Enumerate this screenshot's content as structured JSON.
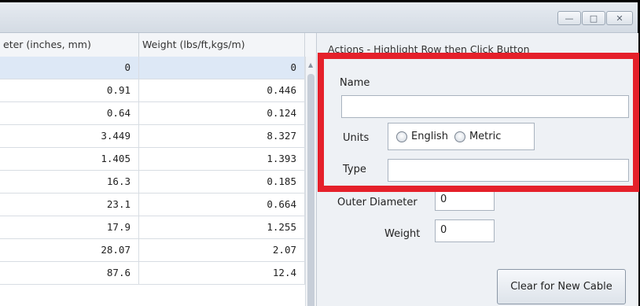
{
  "titlebar": {
    "minimize_icon": "minimize-icon",
    "maximize_icon": "maximize-icon",
    "close_icon": "close-icon"
  },
  "grid": {
    "columns": [
      "eter (inches, mm)",
      "Weight (lbs/ft,kgs/m)"
    ],
    "rows": [
      [
        "0",
        "0"
      ],
      [
        "0.91",
        "0.446"
      ],
      [
        "0.64",
        "0.124"
      ],
      [
        "3.449",
        "8.327"
      ],
      [
        "1.405",
        "1.393"
      ],
      [
        "16.3",
        "0.185"
      ],
      [
        "23.1",
        "0.664"
      ],
      [
        "17.9",
        "1.255"
      ],
      [
        "28.07",
        "2.07"
      ],
      [
        "87.6",
        "12.4"
      ]
    ]
  },
  "panel": {
    "header": "Actions - Highlight Row then Click Button",
    "name_label": "Name",
    "name_value": "",
    "units_label": "Units",
    "units_options": [
      "English",
      "Metric"
    ],
    "type_label": "Type",
    "type_value": "",
    "outer_diameter_label": "Outer Diameter",
    "outer_diameter_value": "0",
    "weight_label": "Weight",
    "weight_value": "0",
    "clear_button": "Clear for New Cable"
  },
  "colors": {
    "highlight_border": "#e5202a"
  }
}
